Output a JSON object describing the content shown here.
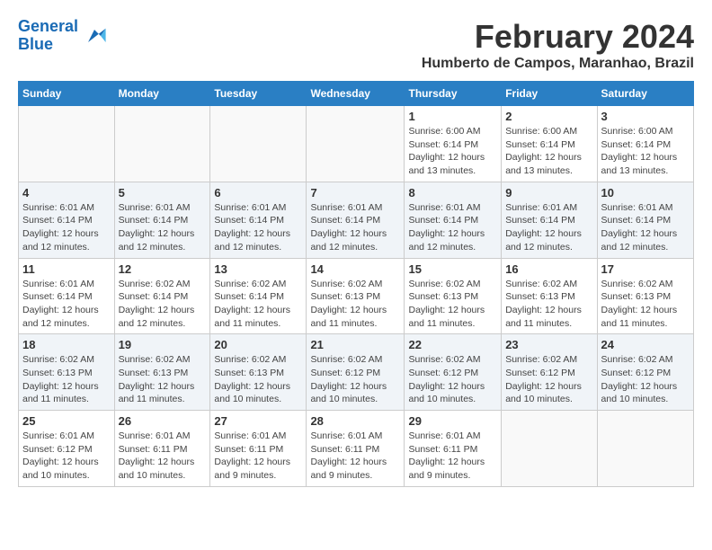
{
  "header": {
    "logo_line1": "General",
    "logo_line2": "Blue",
    "title": "February 2024",
    "subtitle": "Humberto de Campos, Maranhao, Brazil"
  },
  "weekdays": [
    "Sunday",
    "Monday",
    "Tuesday",
    "Wednesday",
    "Thursday",
    "Friday",
    "Saturday"
  ],
  "weeks": [
    [
      {
        "day": "",
        "info": ""
      },
      {
        "day": "",
        "info": ""
      },
      {
        "day": "",
        "info": ""
      },
      {
        "day": "",
        "info": ""
      },
      {
        "day": "1",
        "info": "Sunrise: 6:00 AM\nSunset: 6:14 PM\nDaylight: 12 hours\nand 13 minutes."
      },
      {
        "day": "2",
        "info": "Sunrise: 6:00 AM\nSunset: 6:14 PM\nDaylight: 12 hours\nand 13 minutes."
      },
      {
        "day": "3",
        "info": "Sunrise: 6:00 AM\nSunset: 6:14 PM\nDaylight: 12 hours\nand 13 minutes."
      }
    ],
    [
      {
        "day": "4",
        "info": "Sunrise: 6:01 AM\nSunset: 6:14 PM\nDaylight: 12 hours\nand 12 minutes."
      },
      {
        "day": "5",
        "info": "Sunrise: 6:01 AM\nSunset: 6:14 PM\nDaylight: 12 hours\nand 12 minutes."
      },
      {
        "day": "6",
        "info": "Sunrise: 6:01 AM\nSunset: 6:14 PM\nDaylight: 12 hours\nand 12 minutes."
      },
      {
        "day": "7",
        "info": "Sunrise: 6:01 AM\nSunset: 6:14 PM\nDaylight: 12 hours\nand 12 minutes."
      },
      {
        "day": "8",
        "info": "Sunrise: 6:01 AM\nSunset: 6:14 PM\nDaylight: 12 hours\nand 12 minutes."
      },
      {
        "day": "9",
        "info": "Sunrise: 6:01 AM\nSunset: 6:14 PM\nDaylight: 12 hours\nand 12 minutes."
      },
      {
        "day": "10",
        "info": "Sunrise: 6:01 AM\nSunset: 6:14 PM\nDaylight: 12 hours\nand 12 minutes."
      }
    ],
    [
      {
        "day": "11",
        "info": "Sunrise: 6:01 AM\nSunset: 6:14 PM\nDaylight: 12 hours\nand 12 minutes."
      },
      {
        "day": "12",
        "info": "Sunrise: 6:02 AM\nSunset: 6:14 PM\nDaylight: 12 hours\nand 12 minutes."
      },
      {
        "day": "13",
        "info": "Sunrise: 6:02 AM\nSunset: 6:14 PM\nDaylight: 12 hours\nand 11 minutes."
      },
      {
        "day": "14",
        "info": "Sunrise: 6:02 AM\nSunset: 6:13 PM\nDaylight: 12 hours\nand 11 minutes."
      },
      {
        "day": "15",
        "info": "Sunrise: 6:02 AM\nSunset: 6:13 PM\nDaylight: 12 hours\nand 11 minutes."
      },
      {
        "day": "16",
        "info": "Sunrise: 6:02 AM\nSunset: 6:13 PM\nDaylight: 12 hours\nand 11 minutes."
      },
      {
        "day": "17",
        "info": "Sunrise: 6:02 AM\nSunset: 6:13 PM\nDaylight: 12 hours\nand 11 minutes."
      }
    ],
    [
      {
        "day": "18",
        "info": "Sunrise: 6:02 AM\nSunset: 6:13 PM\nDaylight: 12 hours\nand 11 minutes."
      },
      {
        "day": "19",
        "info": "Sunrise: 6:02 AM\nSunset: 6:13 PM\nDaylight: 12 hours\nand 11 minutes."
      },
      {
        "day": "20",
        "info": "Sunrise: 6:02 AM\nSunset: 6:13 PM\nDaylight: 12 hours\nand 10 minutes."
      },
      {
        "day": "21",
        "info": "Sunrise: 6:02 AM\nSunset: 6:12 PM\nDaylight: 12 hours\nand 10 minutes."
      },
      {
        "day": "22",
        "info": "Sunrise: 6:02 AM\nSunset: 6:12 PM\nDaylight: 12 hours\nand 10 minutes."
      },
      {
        "day": "23",
        "info": "Sunrise: 6:02 AM\nSunset: 6:12 PM\nDaylight: 12 hours\nand 10 minutes."
      },
      {
        "day": "24",
        "info": "Sunrise: 6:02 AM\nSunset: 6:12 PM\nDaylight: 12 hours\nand 10 minutes."
      }
    ],
    [
      {
        "day": "25",
        "info": "Sunrise: 6:01 AM\nSunset: 6:12 PM\nDaylight: 12 hours\nand 10 minutes."
      },
      {
        "day": "26",
        "info": "Sunrise: 6:01 AM\nSunset: 6:11 PM\nDaylight: 12 hours\nand 10 minutes."
      },
      {
        "day": "27",
        "info": "Sunrise: 6:01 AM\nSunset: 6:11 PM\nDaylight: 12 hours\nand 9 minutes."
      },
      {
        "day": "28",
        "info": "Sunrise: 6:01 AM\nSunset: 6:11 PM\nDaylight: 12 hours\nand 9 minutes."
      },
      {
        "day": "29",
        "info": "Sunrise: 6:01 AM\nSunset: 6:11 PM\nDaylight: 12 hours\nand 9 minutes."
      },
      {
        "day": "",
        "info": ""
      },
      {
        "day": "",
        "info": ""
      }
    ]
  ]
}
